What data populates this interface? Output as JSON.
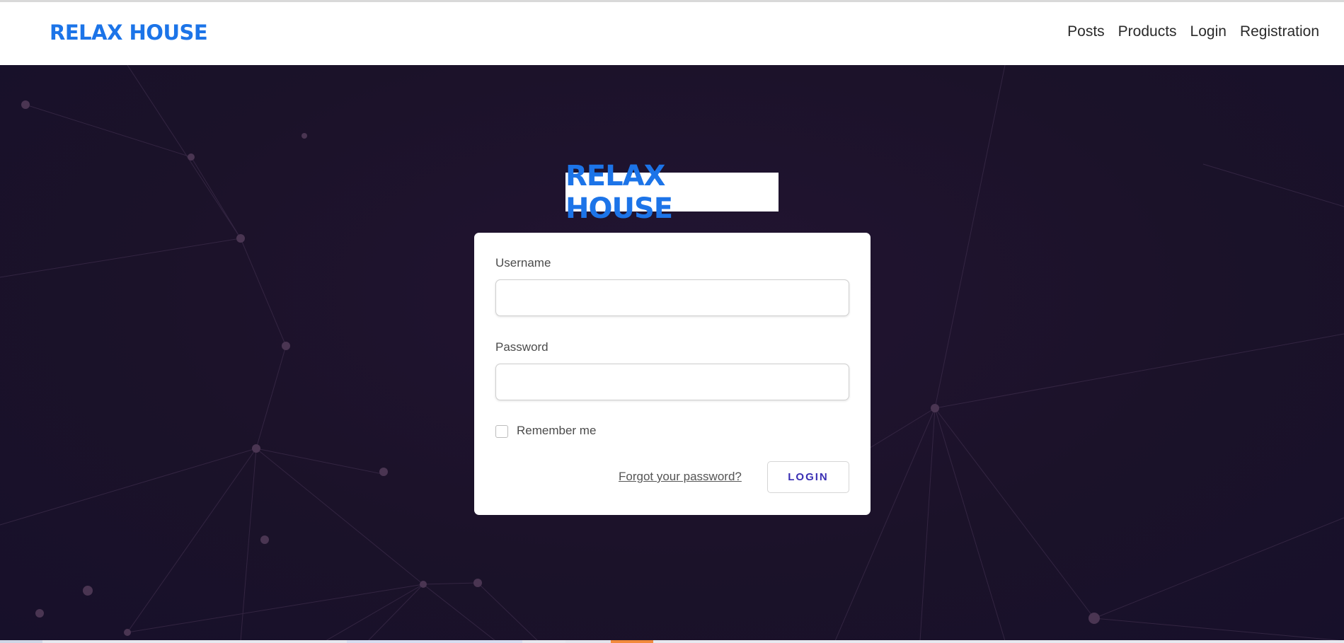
{
  "navbar": {
    "brand": "RELAX HOUSE",
    "links": [
      "Posts",
      "Products",
      "Login",
      "Registration"
    ]
  },
  "hero": {
    "logo_text": "RELAX HOUSE"
  },
  "login_form": {
    "username_label": "Username",
    "username_value": "",
    "password_label": "Password",
    "password_value": "",
    "remember_label": "Remember me",
    "remember_checked": false,
    "forgot_link": "Forgot your password?",
    "submit_label": "LOGIN"
  },
  "colors": {
    "brand": "#1c74e8",
    "hero_background": "#1b1229",
    "button_text": "#3a2fb4"
  }
}
